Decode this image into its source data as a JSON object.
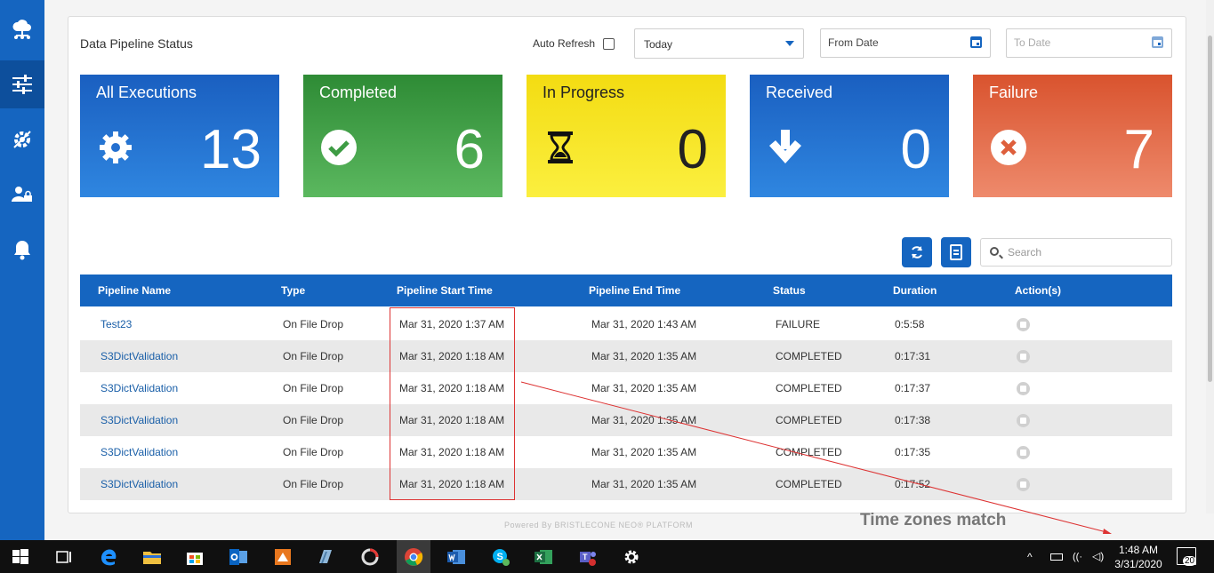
{
  "header": {
    "title": "Data Pipeline Status"
  },
  "filters": {
    "auto_refresh_label": "Auto Refresh",
    "range_value": "Today",
    "from_date_placeholder": "From Date",
    "to_date_placeholder": "To Date"
  },
  "tiles": [
    {
      "label": "All Executions",
      "count": "13",
      "icon": "gear-icon",
      "color": "#1e6fcc"
    },
    {
      "label": "Completed",
      "count": "6",
      "icon": "check-circle-icon",
      "color": "#43a047"
    },
    {
      "label": "In Progress",
      "count": "0",
      "icon": "hourglass-icon",
      "color": "#f5e21b"
    },
    {
      "label": "Received",
      "count": "0",
      "icon": "arrow-down-icon",
      "color": "#1e6fcc"
    },
    {
      "label": "Failure",
      "count": "7",
      "icon": "x-circle-icon",
      "color": "#e0623f"
    }
  ],
  "toolbar": {
    "search_placeholder": "Search"
  },
  "table": {
    "headers": [
      "Pipeline Name",
      "Type",
      "Pipeline Start Time",
      "Pipeline End Time",
      "Status",
      "Duration",
      "Action(s)"
    ],
    "rows": [
      {
        "name": "Test23",
        "type": "On File Drop",
        "start": "Mar 31, 2020 1:37 AM",
        "end": "Mar 31, 2020 1:43 AM",
        "status": "FAILURE",
        "duration": "0:5:58"
      },
      {
        "name": "S3DictValidation",
        "type": "On File Drop",
        "start": "Mar 31, 2020 1:18 AM",
        "end": "Mar 31, 2020 1:35 AM",
        "status": "COMPLETED",
        "duration": "0:17:31"
      },
      {
        "name": "S3DictValidation",
        "type": "On File Drop",
        "start": "Mar 31, 2020 1:18 AM",
        "end": "Mar 31, 2020 1:35 AM",
        "status": "COMPLETED",
        "duration": "0:17:37"
      },
      {
        "name": "S3DictValidation",
        "type": "On File Drop",
        "start": "Mar 31, 2020 1:18 AM",
        "end": "Mar 31, 2020 1:35 AM",
        "status": "COMPLETED",
        "duration": "0:17:38"
      },
      {
        "name": "S3DictValidation",
        "type": "On File Drop",
        "start": "Mar 31, 2020 1:18 AM",
        "end": "Mar 31, 2020 1:35 AM",
        "status": "COMPLETED",
        "duration": "0:17:35"
      },
      {
        "name": "S3DictValidation",
        "type": "On File Drop",
        "start": "Mar 31, 2020 1:18 AM",
        "end": "Mar 31, 2020 1:35 AM",
        "status": "COMPLETED",
        "duration": "0:17:52"
      }
    ]
  },
  "footer": {
    "powered_by": "Powered By BRISTLECONE NEO® PLATFORM"
  },
  "annotation": {
    "text": "Time zones match"
  },
  "taskbar": {
    "time": "1:48 AM",
    "date": "3/31/2020",
    "notifications": "20"
  }
}
